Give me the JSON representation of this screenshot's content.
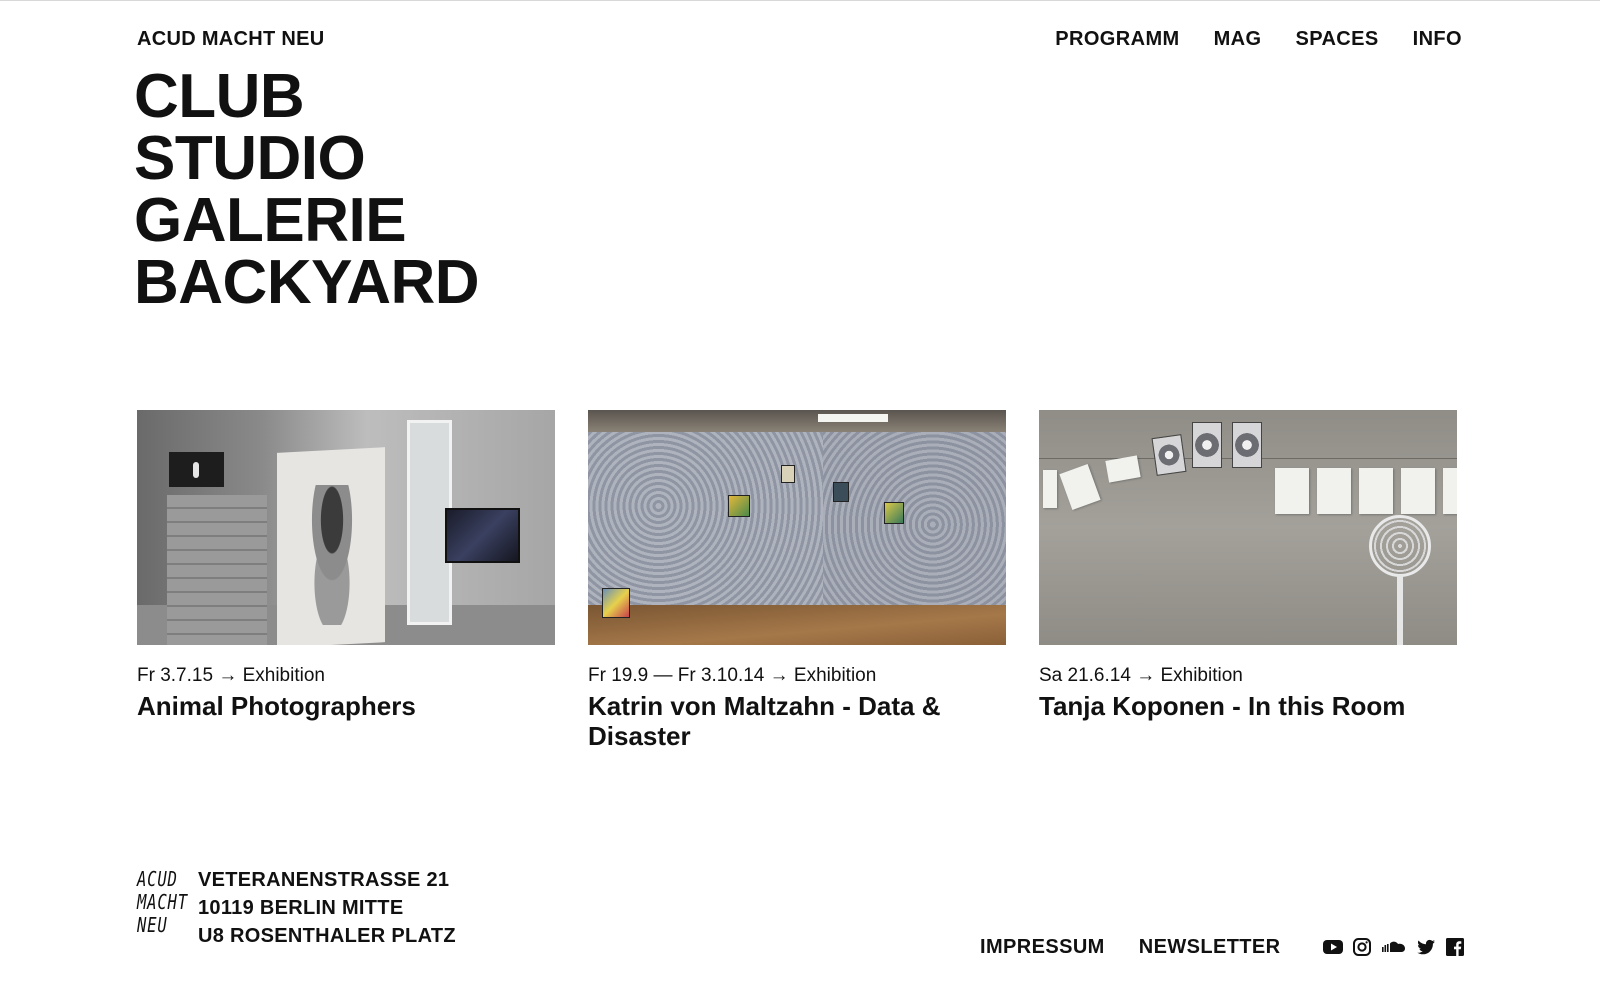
{
  "brand": "ACUD MACHT NEU",
  "nav": {
    "programm": "PROGRAMM",
    "mag": "MAG",
    "spaces": "SPACES",
    "info": "INFO"
  },
  "hero": [
    "CLUB",
    "STUDIO",
    "GALERIE",
    "BACKYARD"
  ],
  "events": [
    {
      "meta": "Fr 3.7.15 → Exhibition",
      "title": "Animal Photographers"
    },
    {
      "meta": "Fr 19.9 — Fr 3.10.14 → Exhibition",
      "title": "Katrin von Maltzahn - Data & Disaster"
    },
    {
      "meta": "Sa 21.6.14 → Exhibition",
      "title": "Tanja Koponen - In this Room"
    }
  ],
  "footer": {
    "logo_lines": [
      "ACUD",
      "MACHT",
      "NEU"
    ],
    "address": [
      "VETERANENSTRASSE 21",
      "10119 BERLIN MITTE",
      "U8 ROSENTHALER PLATZ"
    ],
    "impressum": "IMPRESSUM",
    "newsletter": "NEWSLETTER",
    "social": [
      "youtube-icon",
      "instagram-icon",
      "soundcloud-icon",
      "twitter-icon",
      "facebook-icon"
    ]
  },
  "colors": {
    "text": "#111111",
    "background": "#ffffff"
  }
}
